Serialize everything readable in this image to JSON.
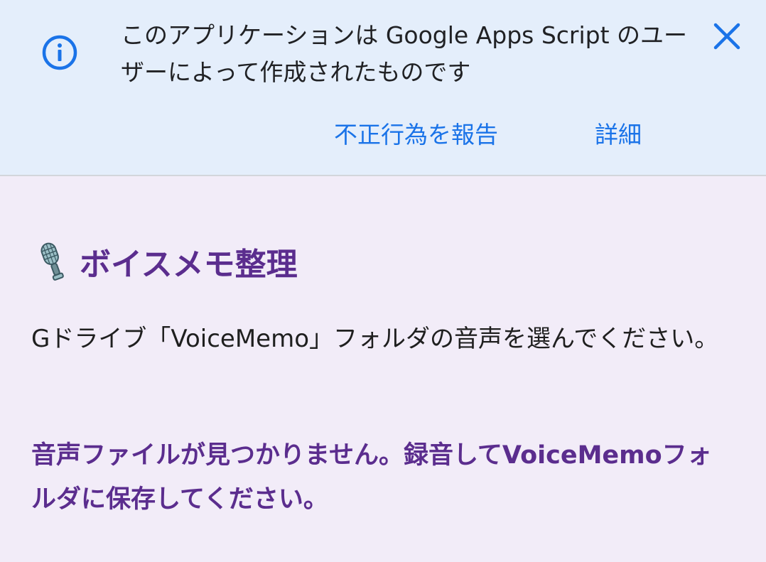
{
  "banner": {
    "message": "このアプリケーションは Google Apps Script のユーザーによって作成されたものです",
    "report_link": "不正行為を報告",
    "details_link": "詳細",
    "info_icon": "info-icon",
    "close_icon": "close-icon",
    "accent_color": "#1a73e8",
    "background_color": "#e4eefb"
  },
  "main": {
    "title_icon": "microphone-icon",
    "title": "ボイスメモ整理",
    "instruction": "Gドライブ「VoiceMemo」フォルダの音声を選んでください。",
    "status_message": "音声ファイルが見つかりません。録音してVoiceMemoフォルダに保存してください。",
    "accent_color": "#5b2d8e",
    "background_color": "#f2ecf8"
  }
}
